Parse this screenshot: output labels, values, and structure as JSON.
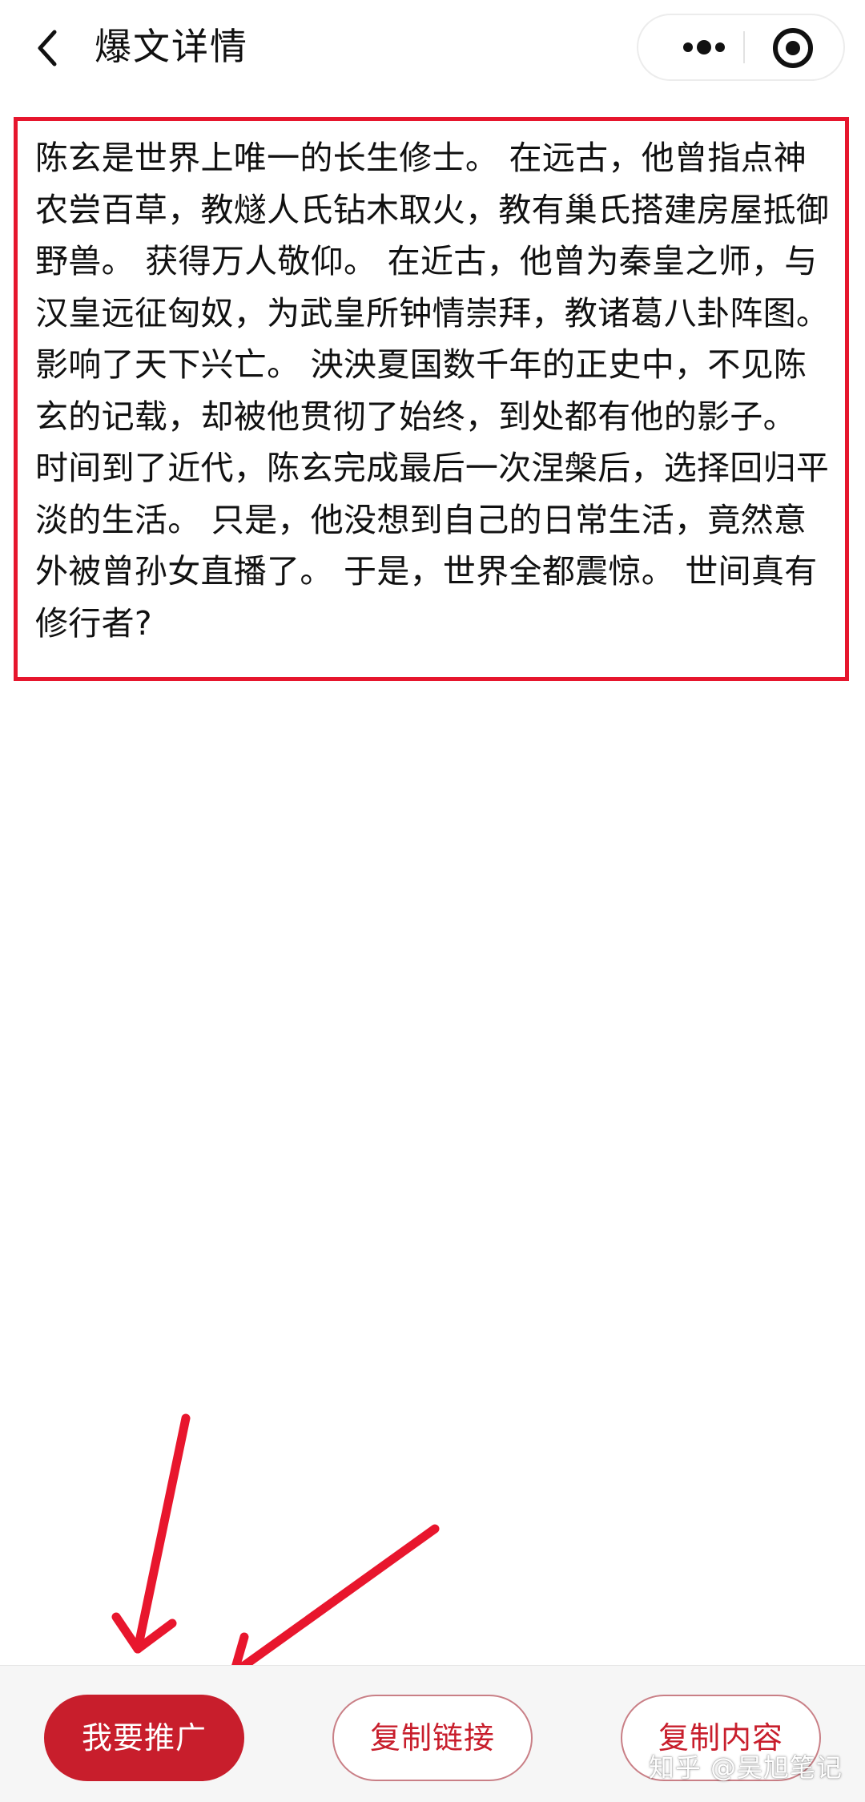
{
  "header": {
    "title": "爆文详情",
    "back_icon": "chevron-left-icon",
    "more_icon": "more-dots-icon",
    "close_icon": "target-close-icon"
  },
  "content": {
    "text": "陈玄是世界上唯一的长生修士。 在远古，他曾指点神农尝百草，教燧人氏钻木取火，教有巢氏搭建房屋抵御野兽。 获得万人敬仰。 在近古，他曾为秦皇之师，与汉皇远征匈奴，为武皇所钟情崇拜，教诸葛八卦阵图。 影响了天下兴亡。 泱泱夏国数千年的正史中，不见陈玄的记载，却被他贯彻了始终，到处都有他的影子。 时间到了近代，陈玄完成最后一次涅槃后，选择回归平淡的生活。 只是，他没想到自己的日常生活，竟然意外被曾孙女直播了。 于是，世界全都震惊。 世间真有修行者?"
  },
  "actions": {
    "promote_label": "我要推广",
    "copy_link_label": "复制链接",
    "copy_content_label": "复制内容"
  },
  "watermark": "知乎 @吴旭笔记",
  "colors": {
    "accent": "#c81e2c",
    "highlight_border": "#e6162d",
    "arrow": "#e8162d"
  }
}
